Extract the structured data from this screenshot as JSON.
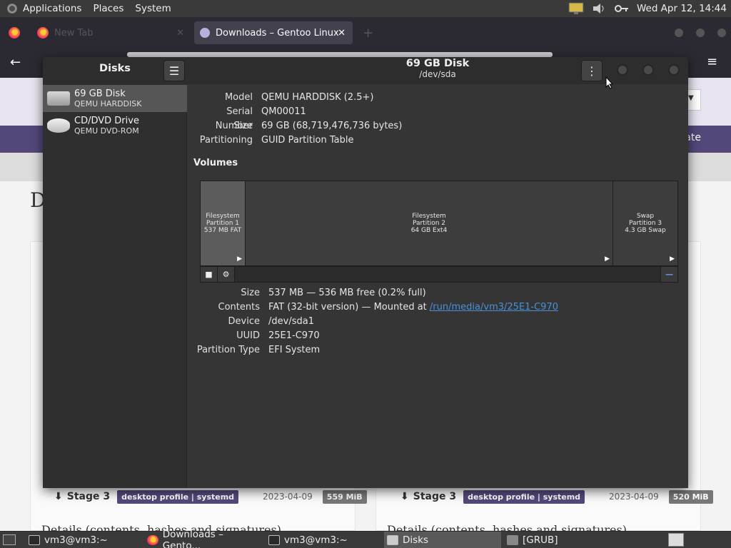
{
  "top_panel": {
    "menus": [
      "Applications",
      "Places",
      "System"
    ],
    "clock": "Wed Apr 12, 14:44"
  },
  "browser": {
    "tabs": [
      {
        "label": "New Tab"
      },
      {
        "label": "Downloads – Gentoo Linux"
      }
    ],
    "nav_partial": "ate",
    "heading_partial": "D",
    "cards": [
      {
        "stage": "Stage 3",
        "profile": "desktop profile | systemd",
        "date": "2023-04-09",
        "size": "559 MiB",
        "details": "Details (contents, hashes and signatures)"
      },
      {
        "stage": "Stage 3",
        "profile": "desktop profile | systemd",
        "date": "2023-04-09",
        "size": "520 MiB",
        "details": "Details (contents, hashes and signatures)"
      }
    ]
  },
  "disks": {
    "sidebar_title": "Disks",
    "drives": [
      {
        "name": "69 GB Disk",
        "model": "QEMU HARDDISK"
      },
      {
        "name": "CD/DVD Drive",
        "model": "QEMU DVD-ROM"
      }
    ],
    "header": {
      "title": "69 GB Disk",
      "subtitle": "/dev/sda"
    },
    "drive_info": [
      {
        "key": "Model",
        "value": "QEMU HARDDISK (2.5+)"
      },
      {
        "key": "Serial Number",
        "value": "QM00011"
      },
      {
        "key": "Size",
        "value": "69 GB (68,719,476,736 bytes)"
      },
      {
        "key": "Partitioning",
        "value": "GUID Partition Table"
      }
    ],
    "volumes_label": "Volumes",
    "volumes": [
      {
        "line1": "Filesystem",
        "line2": "Partition 1",
        "line3": "537 MB FAT"
      },
      {
        "line1": "Filesystem",
        "line2": "Partition 2",
        "line3": "64 GB Ext4"
      },
      {
        "line1": "Swap",
        "line2": "Partition 3",
        "line3": "4.3 GB Swap"
      }
    ],
    "partition_info": {
      "size_key": "Size",
      "size": "537 MB — 536 MB free (0.2% full)",
      "contents_key": "Contents",
      "contents_prefix": "FAT (32-bit version) — Mounted at ",
      "mount_link": "/run/media/vm3/25E1-C970",
      "device_key": "Device",
      "device": "/dev/sda1",
      "uuid_key": "UUID",
      "uuid": "25E1-C970",
      "ptype_key": "Partition Type",
      "ptype": "EFI System"
    }
  },
  "taskbar": {
    "tasks": [
      "vm3@vm3:~",
      "Downloads – Gento...",
      "vm3@vm3:~",
      "Disks",
      "[GRUB]"
    ]
  }
}
